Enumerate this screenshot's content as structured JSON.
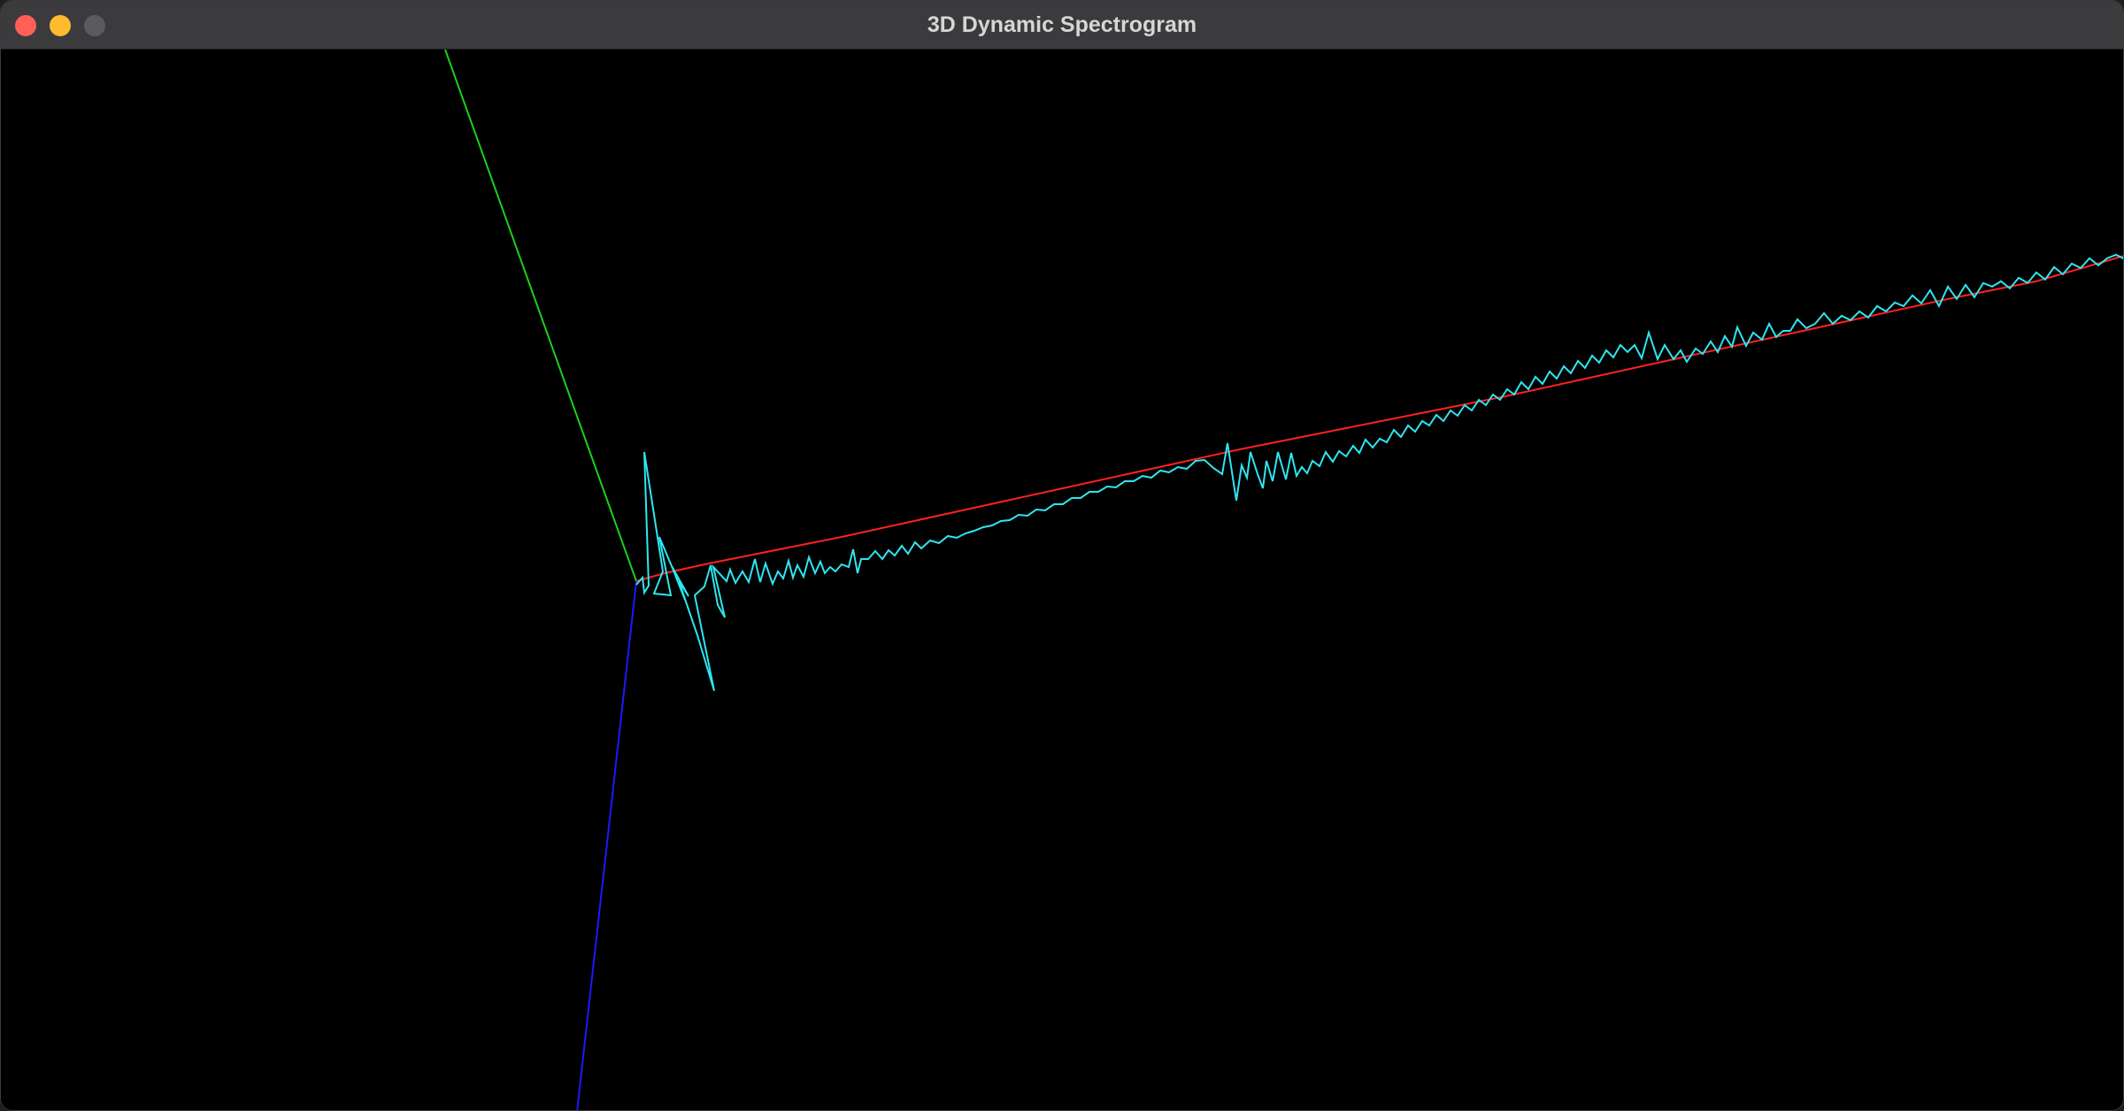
{
  "window": {
    "title": "3D Dynamic Spectrogram",
    "controls": [
      {
        "name": "close-button",
        "color": "#ff5f57"
      },
      {
        "name": "minimize-button",
        "color": "#febc2e"
      },
      {
        "name": "zoom-button",
        "color": "#5b5b5e"
      }
    ]
  },
  "scene": {
    "background": "#000000",
    "axes": [
      {
        "name": "x-axis",
        "color": "#ff2020"
      },
      {
        "name": "y-axis",
        "color": "#19d119"
      },
      {
        "name": "z-axis",
        "color": "#1a1aff"
      }
    ],
    "spectrum_color": "#2ee6f0"
  }
}
